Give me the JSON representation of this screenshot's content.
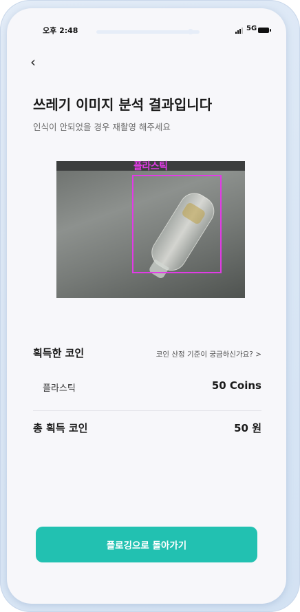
{
  "status": {
    "time": "오후 2:48",
    "network": "5G"
  },
  "nav": {
    "back_icon": "chevron-left-icon"
  },
  "header": {
    "title": "쓰레기 이미지 분석 결과입니다",
    "subtitle": "인식이 안되었을 경우 재촬영 해주세요"
  },
  "detection": {
    "label": "플라스틱",
    "box_color": "#e23be6"
  },
  "coins": {
    "header": "획득한 코인",
    "criteria_link": "코인 산정 기준이 궁금하신가요? >",
    "items": [
      {
        "name": "플라스틱",
        "value": "50 Coins"
      }
    ],
    "total_label": "총 획득 코인",
    "total_value": "50 원"
  },
  "cta": {
    "label": "플로깅으로 돌아가기",
    "color": "#22c1b1"
  }
}
